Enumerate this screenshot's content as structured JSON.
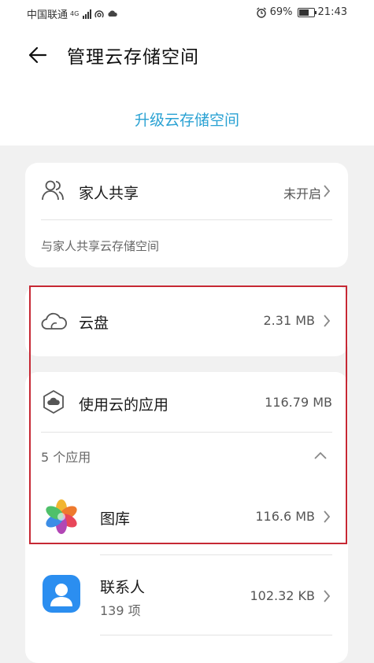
{
  "status_bar": {
    "carrier": "中国联通",
    "network_tag": "4G",
    "battery_pct": "69%",
    "time": "21:43"
  },
  "header": {
    "title": "管理云存储空间"
  },
  "upgrade_label": "升级云存储空间",
  "family": {
    "label": "家人共享",
    "status": "未开启",
    "description": "与家人共享云存储空间"
  },
  "cloud_drive": {
    "label": "云盘",
    "size": "2.31 MB"
  },
  "cloud_apps": {
    "label": "使用云的应用",
    "size": "116.79 MB",
    "count_label": "5 个应用",
    "apps": [
      {
        "name": "图库",
        "size": "116.6 MB",
        "icon": "gallery-icon"
      },
      {
        "name": "联系人",
        "detail": "139 项",
        "size": "102.32 KB",
        "icon": "contacts-icon"
      }
    ]
  },
  "colors": {
    "accent": "#2aa2d3",
    "highlight_border": "#c62834",
    "background": "#f1f1f1"
  }
}
